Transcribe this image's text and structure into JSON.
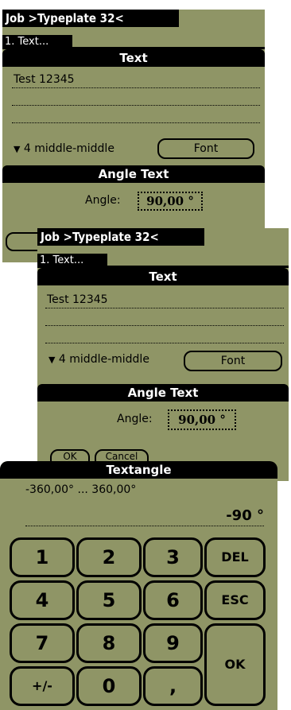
{
  "title_tab": "Job >Typeplate 32<",
  "sub_tab": "1. Text...",
  "text_section": {
    "header": "Text",
    "line1": "Test 12345",
    "alignment": "4 middle-middle",
    "font_button": "Font"
  },
  "angle_section": {
    "header": "Angle Text",
    "angle_label": "Angle:",
    "angle_value": "90,00 °",
    "ok_button": "OK",
    "cancel_button": "Cancel"
  },
  "textangle_dialog": {
    "title": "Textangle",
    "range": "-360,00° ... 360,00°",
    "value": "-90 °",
    "keys": [
      "1",
      "2",
      "3",
      "DEL",
      "4",
      "5",
      "6",
      "ESC",
      "7",
      "8",
      "9",
      "OK",
      "+/-",
      "0",
      ","
    ]
  },
  "colors": {
    "lcd": "#8f9566",
    "ink": "#000000"
  }
}
